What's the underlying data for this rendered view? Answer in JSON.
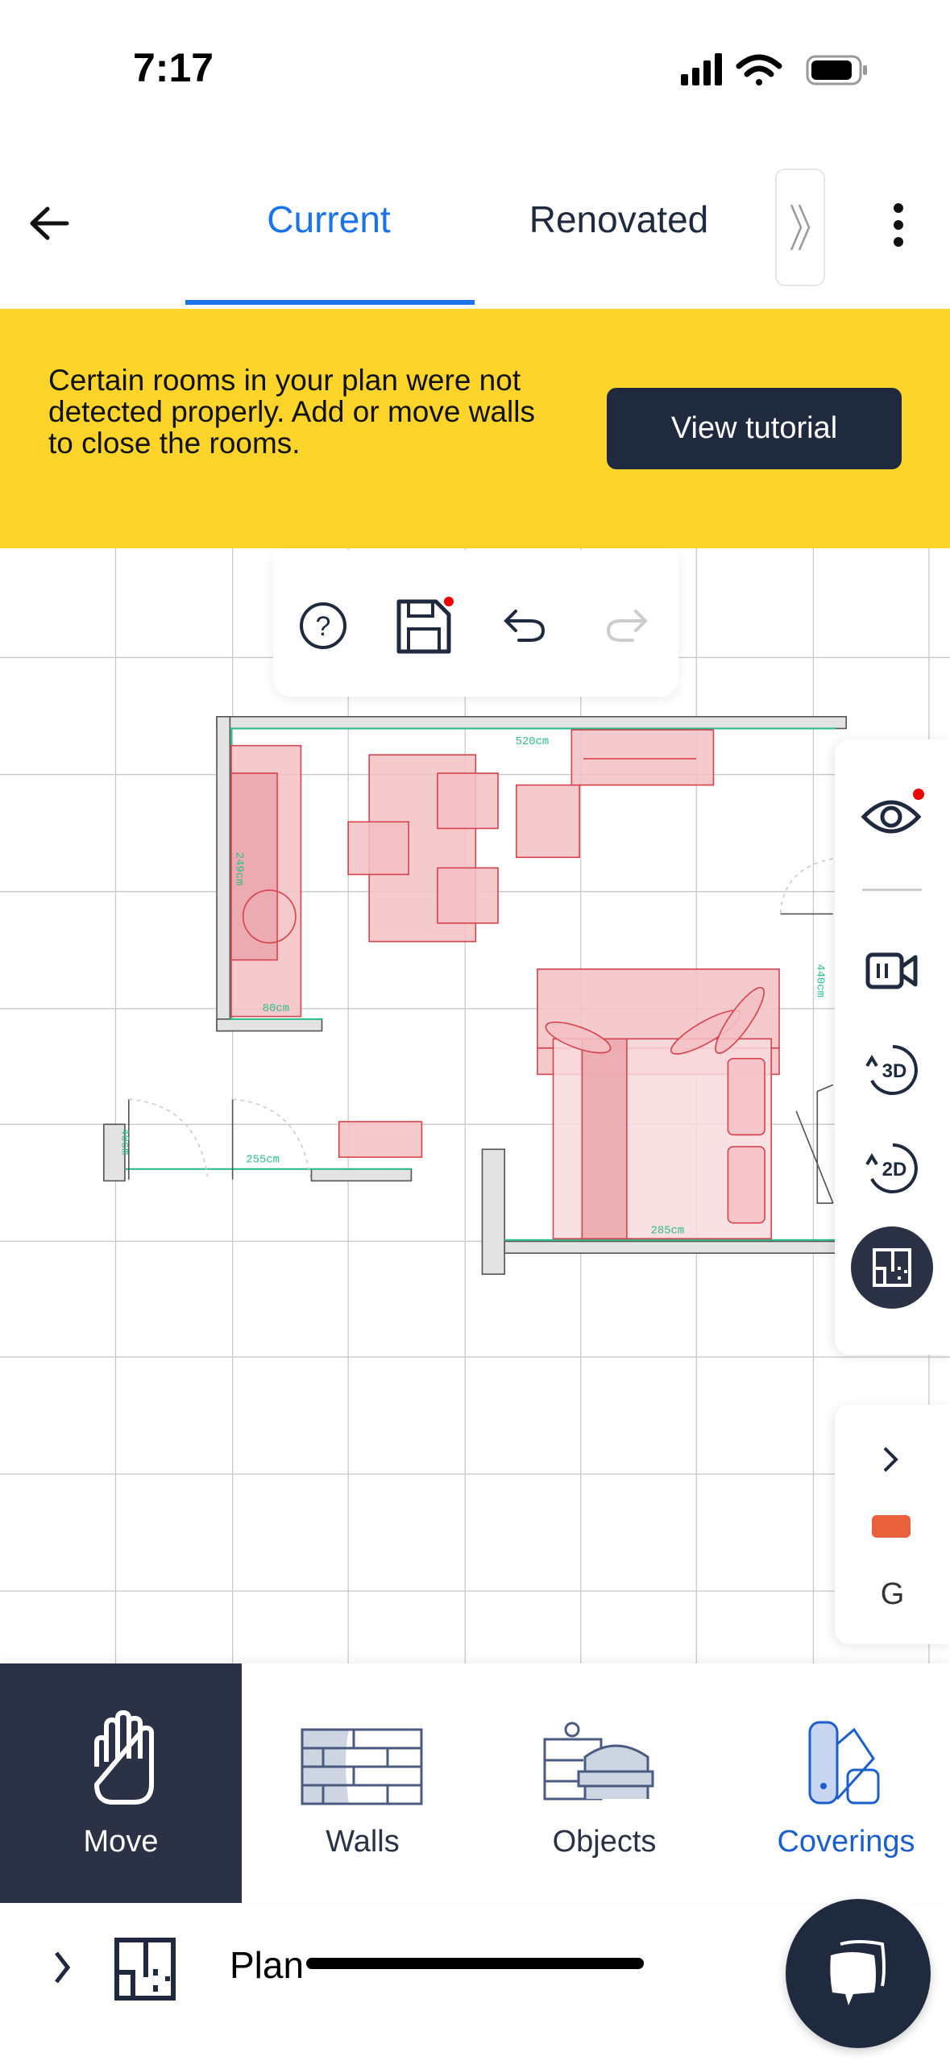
{
  "status_bar": {
    "time": "7:17",
    "icons": [
      "cellular-signal-icon",
      "wifi-icon",
      "battery-icon"
    ]
  },
  "header": {
    "back_icon": "arrow-left-icon",
    "tabs": [
      {
        "label": "Current",
        "active": true
      },
      {
        "label": "Renovated",
        "active": false
      }
    ],
    "more_tabs_icon": "double-chevron-right-icon",
    "menu_icon": "kebab-icon",
    "accent": "#1a73e8"
  },
  "banner": {
    "message": "Certain rooms in your plan were not detected properly. Add or move walls to close the rooms.",
    "button": "View tutorial",
    "color": "#fcd42a"
  },
  "toolbar": {
    "icons": [
      "help-icon",
      "save-icon",
      "undo-icon",
      "redo-icon"
    ],
    "save_unsaved_dot": true
  },
  "plan": {
    "dimensions": [
      "520cm",
      "249cm",
      "80cm",
      "440cm",
      "255cm",
      "40cm",
      "285cm"
    ]
  },
  "side_panel": {
    "icons": [
      "eye-icon",
      "camera-icon",
      "rotate-3d-icon",
      "rotate-2d-icon",
      "floorplan-icon"
    ],
    "expand_icon": "chevron-right-icon",
    "color_swatch": "#e8603c",
    "level_label": "G"
  },
  "bottom_tools": [
    {
      "label": "Move",
      "active": true
    },
    {
      "label": "Walls"
    },
    {
      "label": "Objects"
    },
    {
      "label": "Coverings",
      "highlight": true
    }
  ],
  "footer": {
    "label": "Plan",
    "chat_icon": "chat-bubble-icon"
  }
}
